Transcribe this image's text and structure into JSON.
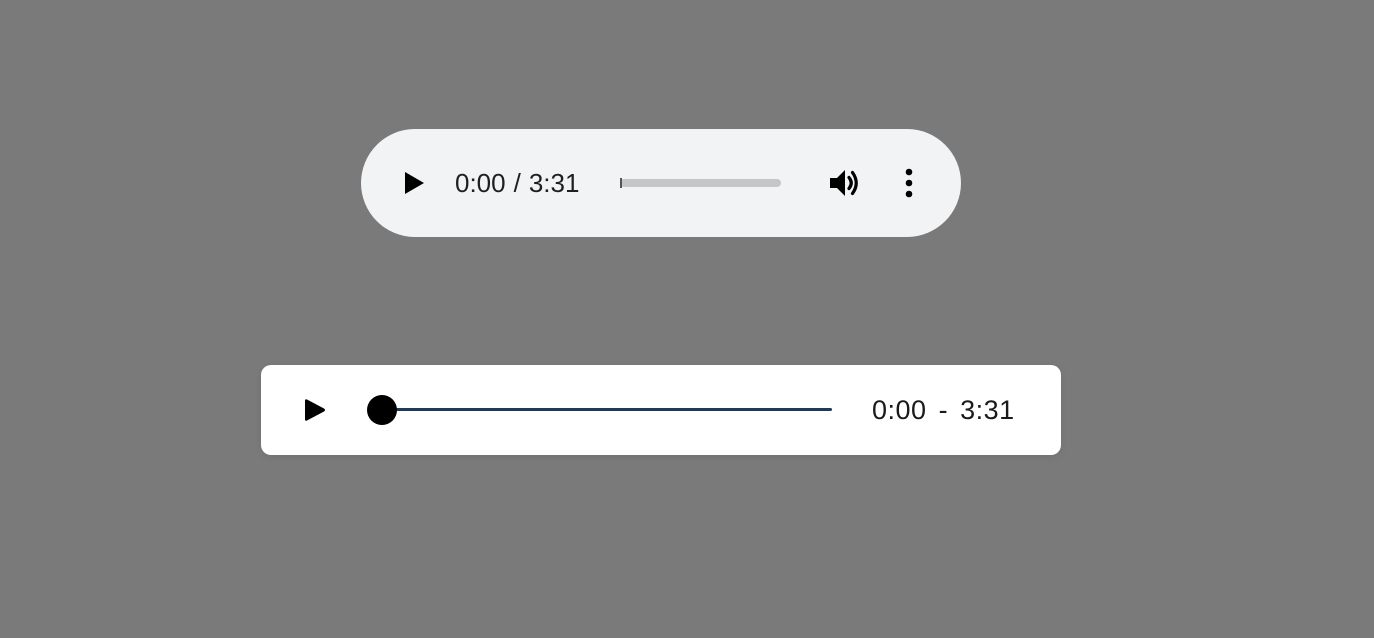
{
  "native_player": {
    "current_time": "0:00",
    "separator": "/",
    "duration": "3:31",
    "progress": 0,
    "icons": {
      "play": "play-icon",
      "volume": "volume-icon",
      "menu": "more-vertical-icon"
    },
    "colors": {
      "background": "#f1f3f4",
      "track": "#c6c6c6"
    }
  },
  "custom_player": {
    "current_time": "0:00",
    "separator": "-",
    "duration": "3:31",
    "progress": 0,
    "icons": {
      "play": "play-icon"
    },
    "colors": {
      "background": "#ffffff",
      "seek_line": "#1e3a5a",
      "knob": "#000000"
    }
  },
  "page": {
    "background": "#7a7a7a"
  }
}
